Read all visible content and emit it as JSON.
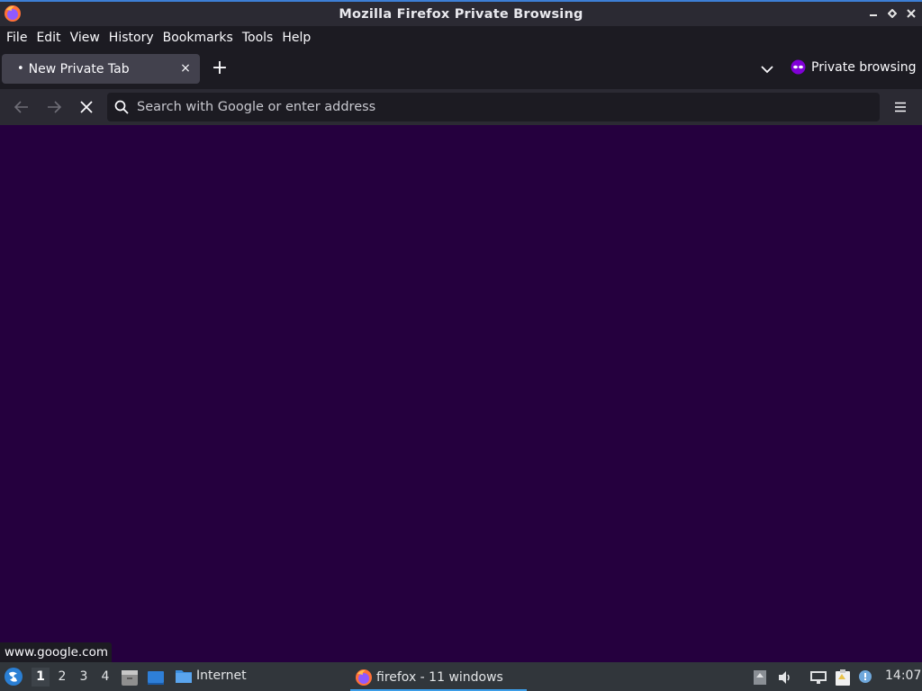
{
  "window": {
    "title": "Mozilla Firefox Private Browsing"
  },
  "menubar": {
    "items": [
      "File",
      "Edit",
      "View",
      "History",
      "Bookmarks",
      "Tools",
      "Help"
    ]
  },
  "tabs": [
    {
      "dot": "•",
      "label": "New Private Tab",
      "close": "×",
      "active": true
    }
  ],
  "tabstrip": {
    "new_tab": "+",
    "private_label": "Private browsing"
  },
  "navbar": {
    "url_placeholder": "Search with Google or enter address",
    "url_value": ""
  },
  "status": {
    "link_url": "www.google.com"
  },
  "taskbar": {
    "workspaces": [
      "1",
      "2",
      "3",
      "4"
    ],
    "active_workspace": "1",
    "launcher_label": "Internet",
    "task_label": "firefox - 11 windows",
    "clock": "14:07"
  },
  "colors": {
    "private_bg": "#25003e",
    "chrome_dark": "#1c1b22",
    "chrome": "#2b2a33",
    "tab_active": "#42414d",
    "private_icon": "#8000d7",
    "taskbar": "#31363b",
    "task_underline": "#3d9ee8"
  },
  "icons": {
    "app": "firefox-icon",
    "back": "back-arrow-icon",
    "forward": "forward-arrow-icon",
    "stop": "stop-icon",
    "search": "search-icon",
    "menu": "hamburger-menu-icon",
    "private": "private-mask-icon",
    "list_tabs": "chevron-down-icon"
  }
}
